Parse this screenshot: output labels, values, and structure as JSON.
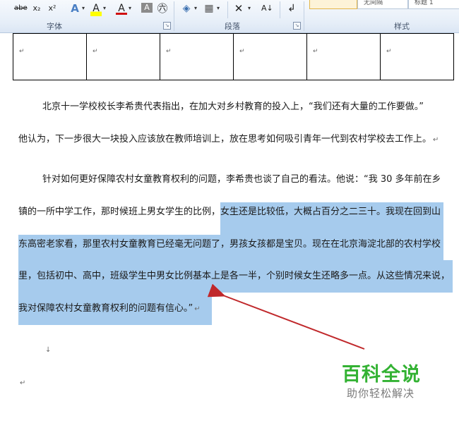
{
  "ribbon": {
    "groups": [
      {
        "label": "字体"
      },
      {
        "label": "段落"
      },
      {
        "label": "样式"
      }
    ],
    "font_buttons": [
      "abe",
      "x₂",
      "x²",
      "A",
      "A",
      "A",
      "A",
      "㊅"
    ],
    "paragraph_buttons": [
      "◈",
      "▦",
      "✕",
      "A↓",
      "↲"
    ],
    "style_items": [
      "",
      "无间隔",
      "标题 1"
    ]
  },
  "document": {
    "table_cell_marks": [
      "↵",
      "↵",
      "↵",
      "↵",
      "↵",
      "↵"
    ],
    "paragraphs": {
      "p1_line1": "北京十一学校校长李希贵代表指出，在加大对乡村教育的投入上，“我们还有大量的工作要做。”",
      "p1_line2": "他认为，下一步很大一块投入应该放在教师培训上，放在思考如何吸引青年一代到农村学校去工作上。",
      "p2_line1": "针对如何更好保障农村女童教育权利的问题，李希贵也谈了自己的看法。他说：“我 30 多年前在乡",
      "p2_line2_plain": "镇的一所中学工作，那时候班上男女学生的比例，",
      "p2_line2_sel": "女生还是比较低，大概占百分之二三十。我现在回到山",
      "p2_line3": "东高密老家看，那里农村女童教育已经毫无问题了，男孩女孩都是宝贝。现在在北京海淀北部的农村学校",
      "p2_line4": "里，包括初中、高中，班级学生中男女比例基本上是各一半，个别时候女生还略多一点。从这些情况来说，",
      "p2_line5": "我对保障农村女童教育权利的问题有信心。”"
    },
    "para_mark": "↵",
    "line_break_mark": "↓"
  },
  "watermark": {
    "title": "百科全说",
    "subtitle": "助你轻松解决"
  },
  "colors": {
    "selection": "#a6cbed",
    "arrow": "#c0282b",
    "watermark_green": "#33b233"
  }
}
